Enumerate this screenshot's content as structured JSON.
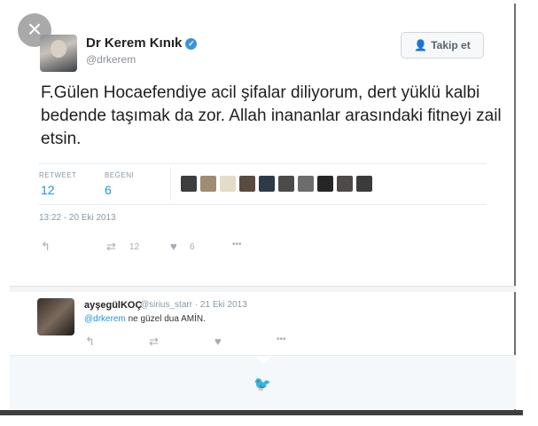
{
  "close": {
    "glyph": "×"
  },
  "tweet": {
    "author_name": "Dr Kerem Kınık",
    "author_handle": "@drkerem",
    "verified_glyph": "✓",
    "follow_label": "Takip et",
    "follow_icon": "person-add-icon",
    "text": "F.Gülen Hocaefendiye acil şifalar diliyorum, dert yüklü kalbi bedende taşımak da zor. Allah inananlar arasındaki fitneyi zail etsin.",
    "retweet_label": "RETWEET",
    "retweet_count": "12",
    "like_label": "BEĞENİ",
    "like_count": "6",
    "timestamp": "13:22 - 20 Eki 2013",
    "actions": {
      "reply_glyph": "↰",
      "retweet_glyph": "⇄",
      "retweet_count": "12",
      "like_glyph": "♥",
      "like_count": "6",
      "more_glyph": "•••"
    }
  },
  "reply": {
    "author_name": "ayşegülKOÇ",
    "meta": "@sirius_starr · 21 Eki 2013",
    "mention": "@drkerem",
    "text": " ne güzel dua AMİN."
  },
  "colors": {
    "link": "#1b95e0",
    "muted": "#8899a6",
    "verified": "#3a92e0"
  }
}
